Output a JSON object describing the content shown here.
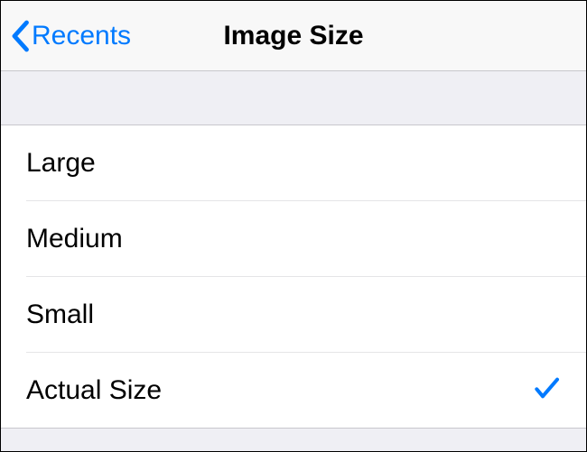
{
  "navbar": {
    "back_label": "Recents",
    "title": "Image Size"
  },
  "options": [
    {
      "label": "Large",
      "selected": false
    },
    {
      "label": "Medium",
      "selected": false
    },
    {
      "label": "Small",
      "selected": false
    },
    {
      "label": "Actual Size",
      "selected": true
    }
  ],
  "colors": {
    "accent": "#007aff"
  }
}
